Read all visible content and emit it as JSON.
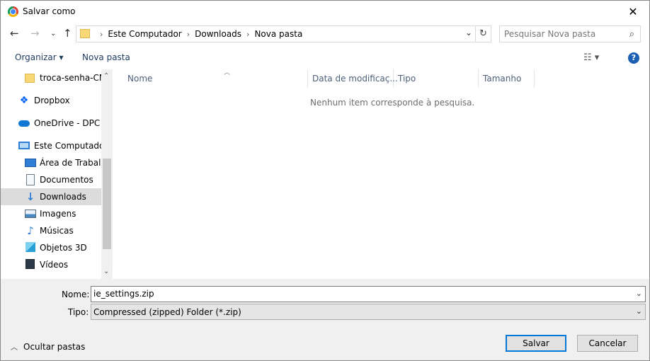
{
  "window": {
    "title": "Salvar como",
    "close_glyph": "✕"
  },
  "address": {
    "breadcrumbs": [
      "Este Computador",
      "Downloads",
      "Nova pasta"
    ],
    "search_placeholder": "Pesquisar Nova pasta"
  },
  "toolbar": {
    "organize_label": "Organizar ▾",
    "new_folder_label": "Nova pasta",
    "view_glyph": "☷ ▾",
    "help_glyph": "?"
  },
  "sidebar": {
    "items": [
      {
        "label": "troca-senha-CM",
        "icon": "folder-icon"
      },
      {
        "label": "Dropbox",
        "icon": "dropbox-icon"
      },
      {
        "label": "OneDrive - DPC S",
        "icon": "onedrive-icon"
      },
      {
        "label": "Este Computador",
        "icon": "computer-icon"
      },
      {
        "label": "Área de Trabalho",
        "icon": "desktop-icon"
      },
      {
        "label": "Documentos",
        "icon": "documents-icon"
      },
      {
        "label": "Downloads",
        "icon": "downloads-icon",
        "selected": true
      },
      {
        "label": "Imagens",
        "icon": "pictures-icon"
      },
      {
        "label": "Músicas",
        "icon": "music-icon"
      },
      {
        "label": "Objetos 3D",
        "icon": "3d-objects-icon"
      },
      {
        "label": "Vídeos",
        "icon": "videos-icon"
      }
    ]
  },
  "filelist": {
    "columns": [
      "Nome",
      "Data de modificaç...",
      "Tipo",
      "Tamanho"
    ],
    "empty_message": "Nenhum item corresponde à pesquisa."
  },
  "form": {
    "name_label": "Nome:",
    "name_value": "ie_settings.zip",
    "type_label": "Tipo:",
    "type_value": "Compressed (zipped) Folder (*.zip)"
  },
  "footer": {
    "hide_folders_label": "Ocultar pastas",
    "save_label": "Salvar",
    "cancel_label": "Cancelar"
  },
  "colors": {
    "accent": "#0078d7",
    "selected_bg": "#dcdcdc",
    "bottom_bg": "#f0f0f0"
  }
}
